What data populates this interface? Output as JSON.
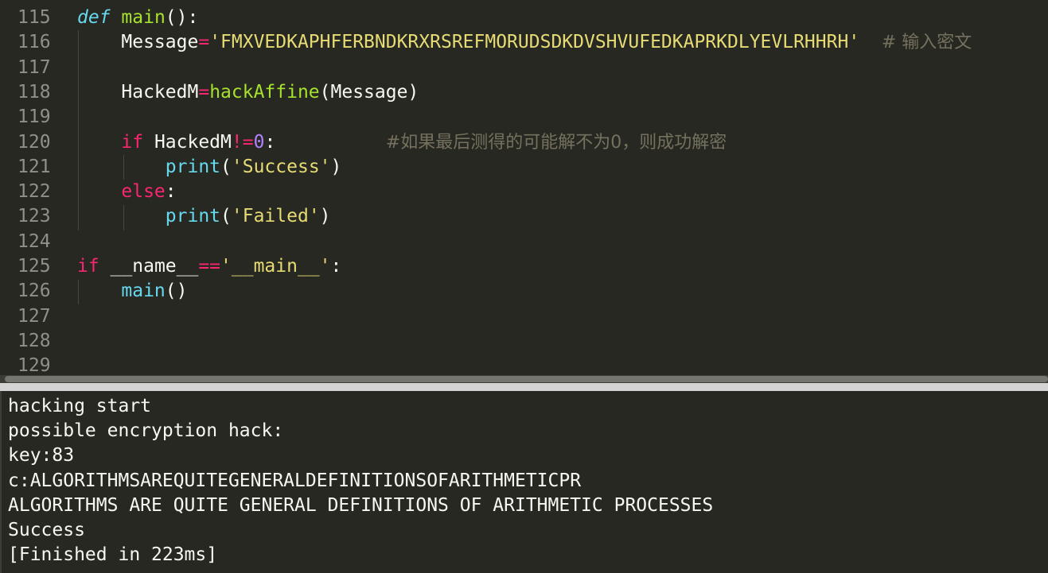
{
  "editor": {
    "lines": [
      {
        "num": "115",
        "tokens": [
          [
            "kw-def",
            "def"
          ],
          [
            "plain",
            " "
          ],
          [
            "fn",
            "main"
          ],
          [
            "plain",
            "():"
          ]
        ]
      },
      {
        "num": "116",
        "tokens": [
          [
            "plain",
            "    Message"
          ],
          [
            "op",
            "="
          ],
          [
            "str",
            "'FMXVEDKAPHFERBNDKRXRSREFMORUDSDKDVSHVUFEDKAPRKDLYEVLRHHRH'"
          ],
          [
            "plain",
            "  "
          ],
          [
            "comment",
            "# 输入密文"
          ]
        ]
      },
      {
        "num": "117",
        "tokens": []
      },
      {
        "num": "118",
        "tokens": [
          [
            "plain",
            "    HackedM"
          ],
          [
            "op",
            "="
          ],
          [
            "fn",
            "hackAffine"
          ],
          [
            "plain",
            "(Message)"
          ]
        ]
      },
      {
        "num": "119",
        "tokens": []
      },
      {
        "num": "120",
        "tokens": [
          [
            "plain",
            "    "
          ],
          [
            "op",
            "if"
          ],
          [
            "plain",
            " HackedM"
          ],
          [
            "op",
            "!="
          ],
          [
            "num",
            "0"
          ],
          [
            "plain",
            ":          "
          ],
          [
            "comment",
            "#如果最后测得的可能解不为0，则成功解密"
          ]
        ]
      },
      {
        "num": "121",
        "tokens": [
          [
            "plain",
            "        "
          ],
          [
            "builtin",
            "print"
          ],
          [
            "plain",
            "("
          ],
          [
            "str",
            "'Success'"
          ],
          [
            "plain",
            ")"
          ]
        ]
      },
      {
        "num": "122",
        "tokens": [
          [
            "plain",
            "    "
          ],
          [
            "op",
            "else"
          ],
          [
            "plain",
            ":"
          ]
        ]
      },
      {
        "num": "123",
        "tokens": [
          [
            "plain",
            "        "
          ],
          [
            "builtin",
            "print"
          ],
          [
            "plain",
            "("
          ],
          [
            "str",
            "'Failed'"
          ],
          [
            "plain",
            ")"
          ]
        ]
      },
      {
        "num": "124",
        "tokens": []
      },
      {
        "num": "125",
        "tokens": [
          [
            "op",
            "if"
          ],
          [
            "plain",
            " __name__"
          ],
          [
            "op",
            "=="
          ],
          [
            "str",
            "'__main__'"
          ],
          [
            "plain",
            ":"
          ]
        ]
      },
      {
        "num": "126",
        "tokens": [
          [
            "plain",
            "    "
          ],
          [
            "builtin",
            "main"
          ],
          [
            "plain",
            "()"
          ]
        ]
      },
      {
        "num": "127",
        "tokens": []
      },
      {
        "num": "128",
        "tokens": []
      },
      {
        "num": "129",
        "tokens": []
      }
    ]
  },
  "console": {
    "lines": [
      "hacking start",
      "possible encryption hack:",
      "key:83",
      "c:ALGORITHMSAREQUITEGENERALDEFINITIONSOFARITHMETICPR",
      "ALGORITHMS ARE QUITE GENERAL DEFINITIONS OF ARITHMETIC PROCESSES",
      "Success",
      "[Finished in 223ms]"
    ]
  },
  "colors": {
    "background": "#272822",
    "keyword": "#f92672",
    "string": "#e6db74",
    "function": "#a6e22e",
    "builtin": "#66d9ef",
    "number": "#ae81ff",
    "comment": "#75715e"
  }
}
